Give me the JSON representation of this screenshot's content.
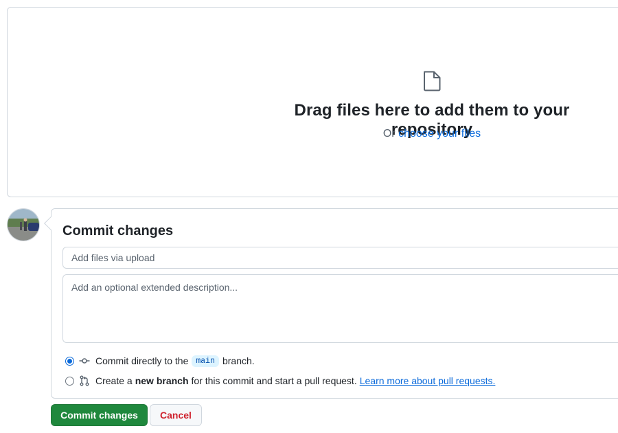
{
  "dropzone": {
    "icon": "file-icon",
    "title": "Drag files here to add them to your repository",
    "prefix": "Or",
    "choose_link": "choose your files"
  },
  "avatar": {
    "icon": "user-avatar-photo"
  },
  "commit": {
    "title": "Commit changes",
    "summary_placeholder": "Add files via upload",
    "summary_value": "",
    "description_placeholder": "Add an optional extended description...",
    "description_value": "",
    "options": [
      {
        "selected": true,
        "icon": "git-commit-icon",
        "text_before": "Commit directly to the",
        "branch": "main",
        "text_after": "branch."
      },
      {
        "selected": false,
        "icon": "git-pull-request-icon",
        "text_before": "Create a",
        "bold": "new branch",
        "text_after": "for this commit and start a pull request.",
        "link": "Learn more about pull requests."
      }
    ]
  },
  "buttons": {
    "commit_label": "Commit changes",
    "cancel_label": "Cancel"
  },
  "colors": {
    "primary_green": "#1f883d",
    "link_blue": "#0969da",
    "danger_red": "#cf222e",
    "border": "#d0d7de"
  }
}
